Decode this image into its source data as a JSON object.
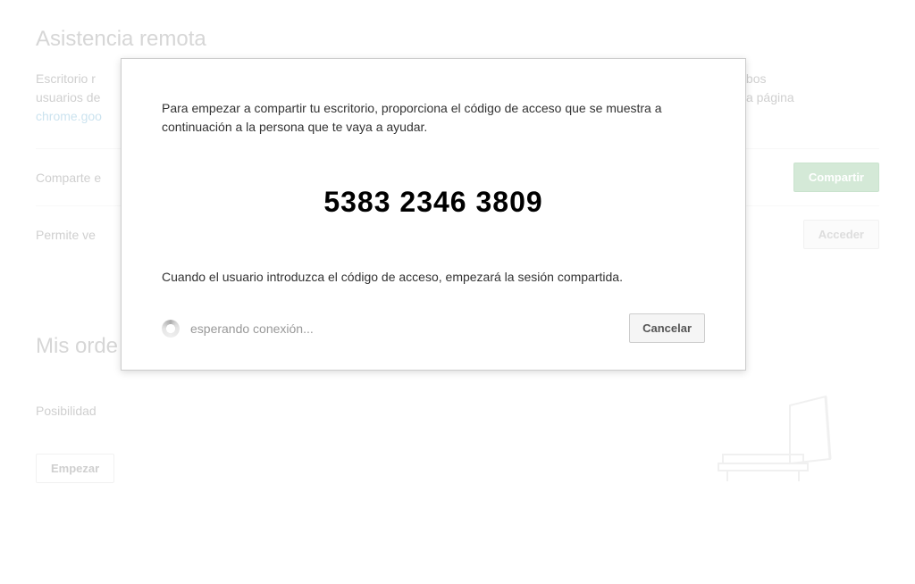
{
  "background": {
    "section1_title": "Asistencia remota",
    "description_line1_start": "Escritorio r",
    "description_line1_end": " Ambos",
    "description_line2_start": "usuarios de",
    "description_line2_end": "n la página",
    "link_text": "chrome.goo",
    "share_label": "Comparte e",
    "share_button": "Compartir",
    "access_label": "Permite ve",
    "access_button": "Acceder",
    "section2_title": "Mis orde",
    "possibility_label": "Posibilidad",
    "start_button": "Empezar"
  },
  "dialog": {
    "instruction_text": "Para empezar a compartir tu escritorio, proporciona el código de acceso que se muestra a continuación a la persona que te vaya a ayudar.",
    "access_code": "5383  2346  3809",
    "info_text": "Cuando el usuario introduzca el código de acceso, empezará la sesión compartida.",
    "status_text": "esperando conexión...",
    "cancel_button": "Cancelar"
  }
}
